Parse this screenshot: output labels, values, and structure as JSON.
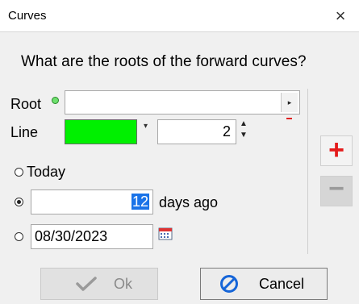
{
  "window": {
    "title": "Curves",
    "close_glyph": "×"
  },
  "question": "What are the roots of the forward curves?",
  "root": {
    "label": "Root",
    "value": "",
    "dropdown_glyph": "▸"
  },
  "line": {
    "label": "Line",
    "color": "#00f000",
    "width_value": "2"
  },
  "options": {
    "today_label": "Today",
    "days_value": "12",
    "days_suffix": "days ago",
    "date_value": "08/30/2023",
    "selected": "days"
  },
  "side_buttons": {
    "add_glyph": "+",
    "remove_glyph": "−"
  },
  "buttons": {
    "ok_label": "Ok",
    "cancel_label": "Cancel"
  },
  "colors": {
    "accent_red": "#e41b1b",
    "cancel_icon_blue": "#1565d8",
    "selection_blue": "#1a73e8"
  }
}
